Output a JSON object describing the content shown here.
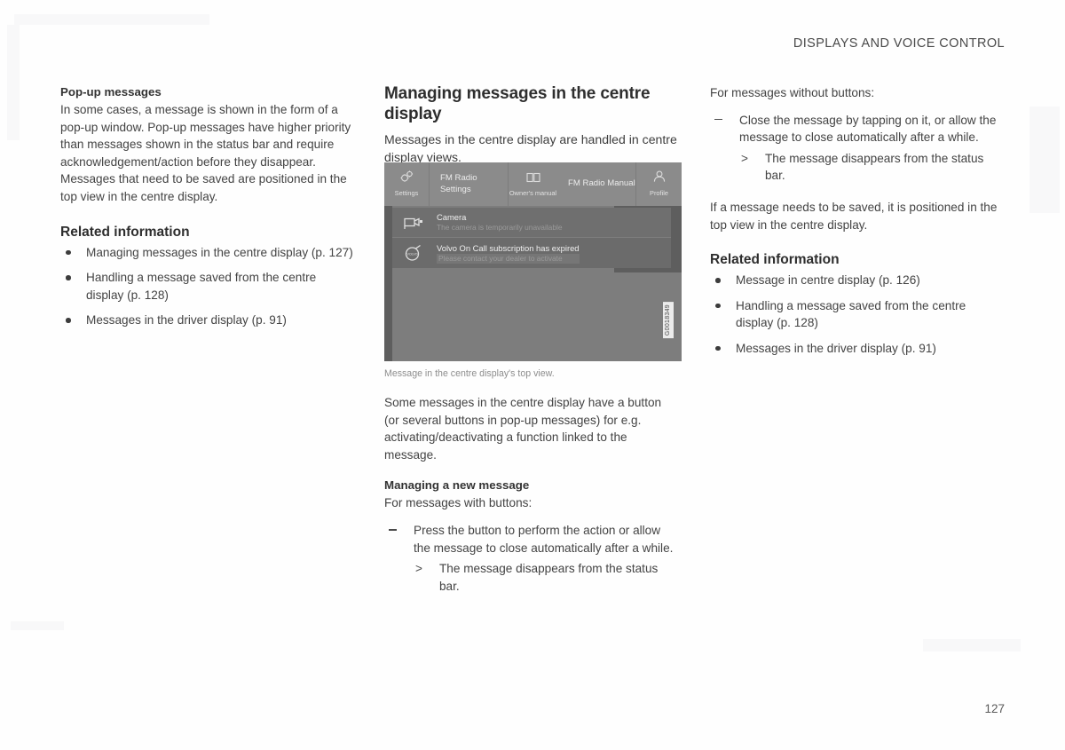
{
  "header": {
    "running_title": "DISPLAYS AND VOICE CONTROL",
    "page_number": "127"
  },
  "column1": {
    "subheading": "Pop-up messages",
    "body": "In some cases, a message is shown in the form of a pop-up window. Pop-up messages have higher priority than messages shown in the status bar and require acknowledgement/action before they disappear. Messages that need to be saved are positioned in the top view in the centre display.",
    "related_title": "Related information",
    "related_items": [
      "Managing messages in the centre display (p. 127)",
      "Handling a message saved from the centre display (p. 128)",
      "Messages in the driver display (p. 91)"
    ]
  },
  "column2": {
    "heading": "Managing messages in the centre display",
    "lead": "Messages in the centre display are handled in centre display views.",
    "figure": {
      "caption": "Message in the centre display's top view.",
      "image_code": "G0018349",
      "topbar": [
        {
          "icon": "gear-settings-icon",
          "label": "Settings",
          "style": "icon-above"
        },
        {
          "icon": null,
          "label": "FM Radio Settings",
          "style": "text-tile"
        },
        {
          "icon": "owners-manual-book-icon",
          "label": "Owner's manual",
          "style": "icon-above"
        },
        {
          "icon": null,
          "label": "FM Radio Manual",
          "style": "text-tile"
        },
        {
          "icon": "profile-person-icon",
          "label": "Profile",
          "style": "icon-above"
        }
      ],
      "messages": [
        {
          "icon": "camera-icon",
          "title": "Camera",
          "subtitle": "The camera is temporarily unavailable"
        },
        {
          "icon": "volvo-on-call-icon",
          "title": "Volvo On Call subscription has expired",
          "subtitle": "Please contact your dealer to activate"
        }
      ]
    },
    "body_after_figure": "Some messages in the centre display have a button (or several buttons in pop-up messages) for e.g. activating/deactivating a function linked to the message.",
    "subheading": "Managing a new message",
    "intro": "For messages with buttons:",
    "step": "Press the button to perform the action or allow the message to close automatically after a while.",
    "substep": "The message disappears from the status bar."
  },
  "column3": {
    "intro": "For messages without buttons:",
    "step": "Close the message by tapping on it, or allow the message to close automatically after a while.",
    "substep": "The message disappears from the status bar.",
    "body": "If a message needs to be saved, it is positioned in the top view in the centre display.",
    "related_title": "Related information",
    "related_items": [
      "Message in centre display (p. 126)",
      "Handling a message saved from the centre display (p. 128)",
      "Messages in the driver display (p. 91)"
    ]
  },
  "colors": {
    "page_bg": "#fefefe",
    "text": "#434343",
    "display_bg": "#7d7d7d",
    "display_topbar": "#8b8b8b",
    "message_row": "#6f6f6f"
  }
}
